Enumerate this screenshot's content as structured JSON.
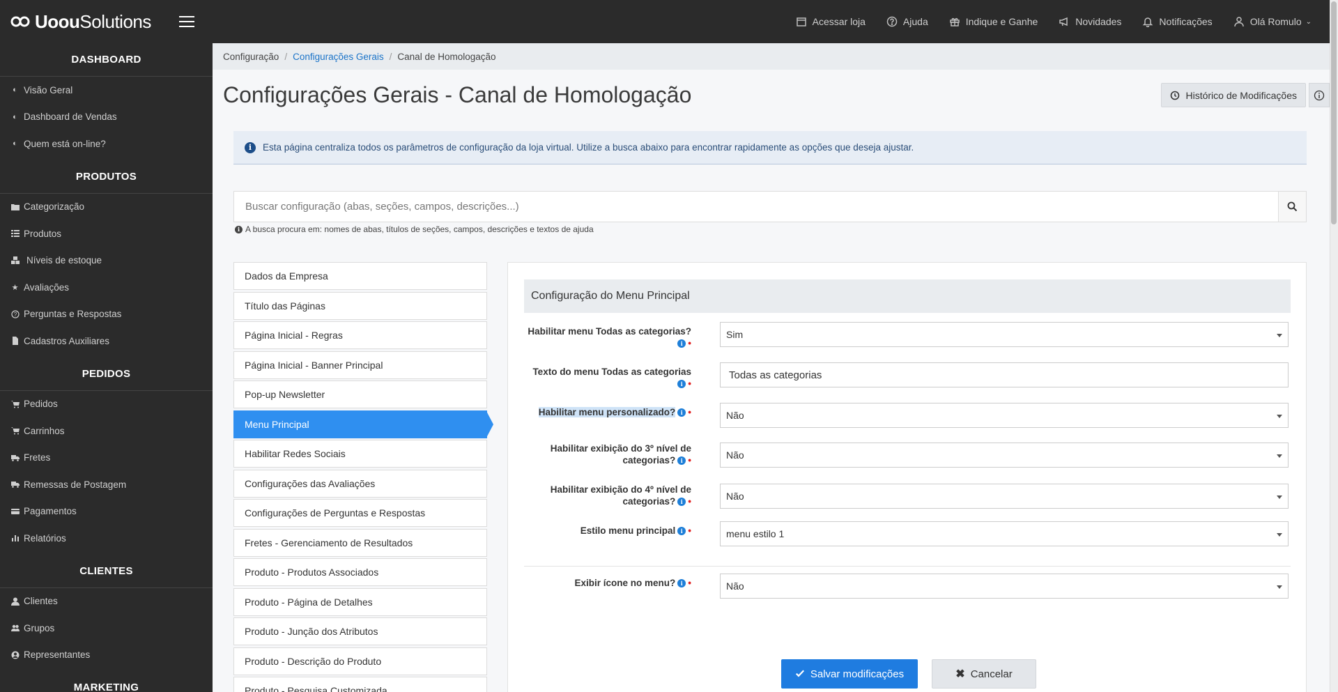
{
  "header": {
    "logo_text_bold": "Uoou",
    "logo_text_light": "Solutions",
    "nav": [
      {
        "label": "Acessar loja",
        "icon": "store-icon"
      },
      {
        "label": "Ajuda",
        "icon": "help-icon"
      },
      {
        "label": "Indique e Ganhe",
        "icon": "gift-icon"
      },
      {
        "label": "Novidades",
        "icon": "megaphone-icon"
      },
      {
        "label": "Notificações",
        "icon": "bell-icon"
      },
      {
        "label": "Olá Romulo",
        "icon": "user-icon"
      }
    ]
  },
  "sidebar": {
    "sections": [
      {
        "title": "DASHBOARD",
        "items": [
          {
            "label": "Visão Geral",
            "icon": "gauge-icon"
          },
          {
            "label": "Dashboard de Vendas",
            "icon": "gauge-icon"
          },
          {
            "label": "Quem está on-line?",
            "icon": "gauge-icon"
          }
        ]
      },
      {
        "title": "PRODUTOS",
        "items": [
          {
            "label": "Categorização",
            "icon": "folder-icon"
          },
          {
            "label": "Produtos",
            "icon": "list-icon"
          },
          {
            "label": "Níveis de estoque",
            "icon": "cubes-icon"
          },
          {
            "label": "Avaliações",
            "icon": "star-icon"
          },
          {
            "label": "Perguntas e Respostas",
            "icon": "question-icon"
          },
          {
            "label": "Cadastros Auxiliares",
            "icon": "file-icon"
          }
        ]
      },
      {
        "title": "PEDIDOS",
        "items": [
          {
            "label": "Pedidos",
            "icon": "cart-icon"
          },
          {
            "label": "Carrinhos",
            "icon": "cart-icon"
          },
          {
            "label": "Fretes",
            "icon": "truck-icon"
          },
          {
            "label": "Remessas de Postagem",
            "icon": "truck-icon"
          },
          {
            "label": "Pagamentos",
            "icon": "credit-card-icon"
          },
          {
            "label": "Relatórios",
            "icon": "bar-chart-icon"
          }
        ]
      },
      {
        "title": "CLIENTES",
        "items": [
          {
            "label": "Clientes",
            "icon": "user-icon"
          },
          {
            "label": "Grupos",
            "icon": "users-icon"
          },
          {
            "label": "Representantes",
            "icon": "user-circle-icon"
          }
        ]
      },
      {
        "title": "MARKETING",
        "items": []
      }
    ]
  },
  "breadcrumb": {
    "items": [
      "Configuração",
      "Configurações Gerais",
      "Canal de Homologação"
    ]
  },
  "page": {
    "title": "Configurações Gerais - Canal de Homologação",
    "history_button": "Histórico de Modificações",
    "alert_text": "Esta página centraliza todos os parâmetros de configuração da loja virtual. Utilize a busca abaixo para encontrar rapidamente as opções que deseja ajustar.",
    "search_placeholder": "Buscar configuração (abas, seções, campos, descrições...)",
    "search_hint": "A busca procura em: nomes de abas, títulos de seções, campos, descrições e textos de ajuda"
  },
  "tabs": [
    "Dados da Empresa",
    "Título das Páginas",
    "Página Inicial - Regras",
    "Página Inicial - Banner Principal",
    "Pop-up Newsletter",
    "Menu Principal",
    "Habilitar Redes Sociais",
    "Configurações das Avaliações",
    "Configurações de Perguntas e Respostas",
    "Fretes - Gerenciamento de Resultados",
    "Produto - Produtos Associados",
    "Produto - Página de Detalhes",
    "Produto - Junção dos Atributos",
    "Produto - Descrição do Produto",
    "Produto - Pesquisa Customizada"
  ],
  "active_tab": "Menu Principal",
  "form": {
    "section_title": "Configuração do Menu Principal",
    "fields": [
      {
        "label_line1": "Habilitar menu Todas as categorias?",
        "label_line2": "",
        "value": "Sim",
        "type": "select"
      },
      {
        "label_line1": "Texto do menu Todas as categorias",
        "label_line2": "",
        "value": "Todas as categorias",
        "type": "text"
      },
      {
        "label_line1": "Habilitar menu personalizado?",
        "label_line2": "",
        "value": "Não",
        "type": "select"
      },
      {
        "label_line1": "Habilitar exibição do 3º nível de",
        "label_line2": "categorias?",
        "value": "Não",
        "type": "select"
      },
      {
        "label_line1": "Habilitar exibição do 4º nível de",
        "label_line2": "categorias?",
        "value": "Não",
        "type": "select"
      },
      {
        "label_line1": "Estilo menu principal",
        "label_line2": "",
        "value": "menu estilo 1",
        "type": "select"
      },
      {
        "label_line1": "Exibir ícone no menu?",
        "label_line2": "",
        "value": "Não",
        "type": "select"
      }
    ],
    "save_label": "Salvar modificações",
    "cancel_label": "Cancelar"
  },
  "colors": {
    "sidebar_bg": "#2b2b2b",
    "accent": "#2f8ff0",
    "primary_button": "#1f7ce0",
    "required": "#e02020"
  }
}
